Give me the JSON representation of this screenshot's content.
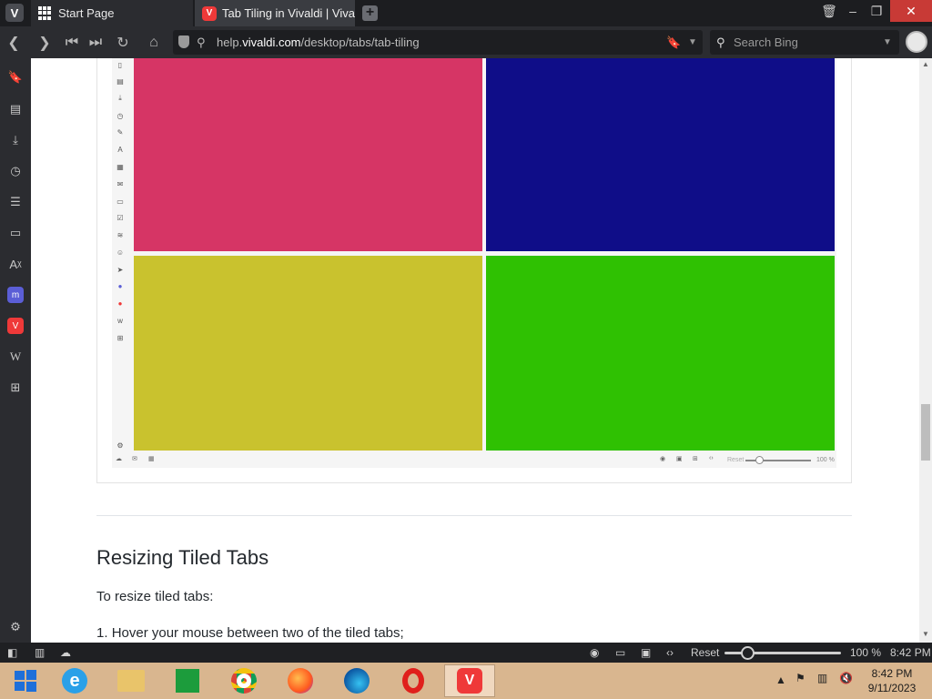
{
  "browser": {
    "tabs": [
      {
        "label": "Start Page",
        "active": false
      },
      {
        "label": "Tab Tiling in Vivaldi | Vivaldi",
        "active": true
      }
    ],
    "url": {
      "prefix": "help.",
      "domain": "vivaldi.com",
      "path": "/desktop/tabs/tab-tiling"
    },
    "search_placeholder": "Search Bing"
  },
  "colors": {
    "tile_pink": "#d63565",
    "tile_navy": "#0f0d88",
    "tile_olive": "#c9c22e",
    "tile_green": "#2fc102",
    "close_red": "#c83a36",
    "accent_red": "#ef3939"
  },
  "panel_icons": [
    "bookmark-icon",
    "reading-list-icon",
    "download-icon",
    "history-icon",
    "notes-icon",
    "window-icon",
    "translate-icon",
    "mastodon-icon",
    "vivaldi-icon",
    "wikipedia-icon",
    "add-panel-icon",
    "settings-icon"
  ],
  "figure": {
    "mini_reset": "Reset",
    "mini_zoom": "100 %"
  },
  "article": {
    "section_heading": "Resizing Tiled Tabs",
    "intro": "To resize tiled tabs:",
    "steps": [
      "Hover your mouse between two of the tiled tabs;"
    ]
  },
  "statusbar": {
    "reset_label": "Reset",
    "zoom": "100 %",
    "time": "8:42 PM",
    "zoom_fraction": 0.2
  },
  "taskbar": {
    "clock_time": "8:42 PM",
    "clock_date": "9/11/2023",
    "apps": [
      "windows-start-icon",
      "internet-explorer-icon",
      "file-explorer-icon",
      "store-icon",
      "chrome-icon",
      "firefox-icon",
      "edge-icon",
      "opera-icon",
      "vivaldi-icon"
    ]
  }
}
